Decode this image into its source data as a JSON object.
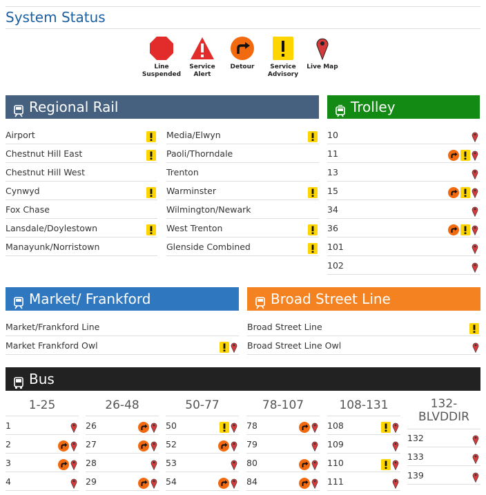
{
  "page_title": "System Status",
  "legend": [
    {
      "label_line1": "Line",
      "label_line2": "Suspended",
      "icon": "stop-sign-icon"
    },
    {
      "label_line1": "Service",
      "label_line2": "Alert",
      "icon": "warning-triangle-icon"
    },
    {
      "label_line1": "Detour",
      "label_line2": "",
      "icon": "detour-icon"
    },
    {
      "label_line1": "Service",
      "label_line2": "Advisory",
      "icon": "advisory-icon"
    },
    {
      "label_line1": "Live Map",
      "label_line2": "",
      "icon": "map-pin-icon"
    }
  ],
  "colors": {
    "regional_rail": "#466080",
    "trolley": "#138a13",
    "market_frankford": "#2f78c0",
    "broad_street": "#f58220",
    "bus": "#222222",
    "title": "#1a5fa0",
    "advisory": "#ffd500",
    "detour": "#f26a10",
    "pin": "#d43a3a"
  },
  "regional_rail": {
    "title": "Regional Rail",
    "left": [
      {
        "name": "Airport",
        "icons": [
          "advisory"
        ]
      },
      {
        "name": "Chestnut Hill East",
        "icons": [
          "advisory"
        ]
      },
      {
        "name": "Chestnut Hill West",
        "icons": []
      },
      {
        "name": "Cynwyd",
        "icons": [
          "advisory"
        ]
      },
      {
        "name": "Fox Chase",
        "icons": []
      },
      {
        "name": "Lansdale/Doylestown",
        "icons": [
          "advisory"
        ]
      },
      {
        "name": "Manayunk/Norristown",
        "icons": []
      }
    ],
    "right": [
      {
        "name": "Media/Elwyn",
        "icons": [
          "advisory"
        ]
      },
      {
        "name": "Paoli/Thorndale",
        "icons": []
      },
      {
        "name": "Trenton",
        "icons": []
      },
      {
        "name": "Warminster",
        "icons": [
          "advisory"
        ]
      },
      {
        "name": "Wilmington/Newark",
        "icons": []
      },
      {
        "name": "West Trenton",
        "icons": [
          "advisory"
        ]
      },
      {
        "name": "Glenside Combined",
        "icons": [
          "advisory"
        ]
      }
    ]
  },
  "trolley": {
    "title": "Trolley",
    "routes": [
      {
        "name": "10",
        "icons": [
          "pin"
        ]
      },
      {
        "name": "11",
        "icons": [
          "detour",
          "advisory",
          "pin"
        ]
      },
      {
        "name": "13",
        "icons": [
          "pin"
        ]
      },
      {
        "name": "15",
        "icons": [
          "detour",
          "advisory",
          "pin"
        ]
      },
      {
        "name": "34",
        "icons": [
          "pin"
        ]
      },
      {
        "name": "36",
        "icons": [
          "detour",
          "advisory",
          "pin"
        ]
      },
      {
        "name": "101",
        "icons": [
          "pin"
        ]
      },
      {
        "name": "102",
        "icons": [
          "pin"
        ]
      }
    ]
  },
  "market_frankford": {
    "title": "Market/ Frankford",
    "routes": [
      {
        "name": "Market/Frankford Line",
        "icons": []
      },
      {
        "name": "Market Frankford Owl",
        "icons": [
          "advisory",
          "pin"
        ]
      }
    ]
  },
  "broad_street": {
    "title": "Broad Street Line",
    "routes": [
      {
        "name": "Broad Street Line",
        "icons": [
          "advisory"
        ]
      },
      {
        "name": "Broad Street Line Owl",
        "icons": [
          "pin"
        ]
      }
    ]
  },
  "bus": {
    "title": "Bus",
    "columns": [
      {
        "header": "1-25",
        "routes": [
          {
            "name": "1",
            "icons": [
              "pin"
            ]
          },
          {
            "name": "2",
            "icons": [
              "detour",
              "pin"
            ]
          },
          {
            "name": "3",
            "icons": [
              "detour",
              "pin"
            ]
          },
          {
            "name": "4",
            "icons": [
              "pin"
            ]
          }
        ]
      },
      {
        "header": "26-48",
        "routes": [
          {
            "name": "26",
            "icons": [
              "detour",
              "pin"
            ]
          },
          {
            "name": "27",
            "icons": [
              "detour",
              "pin"
            ]
          },
          {
            "name": "28",
            "icons": [
              "pin"
            ]
          },
          {
            "name": "29",
            "icons": [
              "detour",
              "pin"
            ]
          }
        ]
      },
      {
        "header": "50-77",
        "routes": [
          {
            "name": "50",
            "icons": [
              "advisory",
              "pin"
            ]
          },
          {
            "name": "52",
            "icons": [
              "detour",
              "pin"
            ]
          },
          {
            "name": "53",
            "icons": [
              "pin"
            ]
          },
          {
            "name": "54",
            "icons": [
              "detour",
              "pin"
            ]
          }
        ]
      },
      {
        "header": "78-107",
        "routes": [
          {
            "name": "78",
            "icons": [
              "detour",
              "pin"
            ]
          },
          {
            "name": "79",
            "icons": [
              "pin"
            ]
          },
          {
            "name": "80",
            "icons": [
              "detour",
              "pin"
            ]
          },
          {
            "name": "84",
            "icons": [
              "detour",
              "pin"
            ]
          }
        ]
      },
      {
        "header": "108-131",
        "routes": [
          {
            "name": "108",
            "icons": [
              "advisory",
              "pin"
            ]
          },
          {
            "name": "109",
            "icons": [
              "pin"
            ]
          },
          {
            "name": "110",
            "icons": [
              "advisory",
              "pin"
            ]
          },
          {
            "name": "111",
            "icons": [
              "pin"
            ]
          }
        ]
      },
      {
        "header_line1": "132-",
        "header_line2": "BLVDDIR",
        "routes": [
          {
            "name": "132",
            "icons": [
              "pin"
            ]
          },
          {
            "name": "133",
            "icons": [
              "pin"
            ]
          },
          {
            "name": "139",
            "icons": [
              "pin"
            ]
          }
        ]
      }
    ]
  }
}
